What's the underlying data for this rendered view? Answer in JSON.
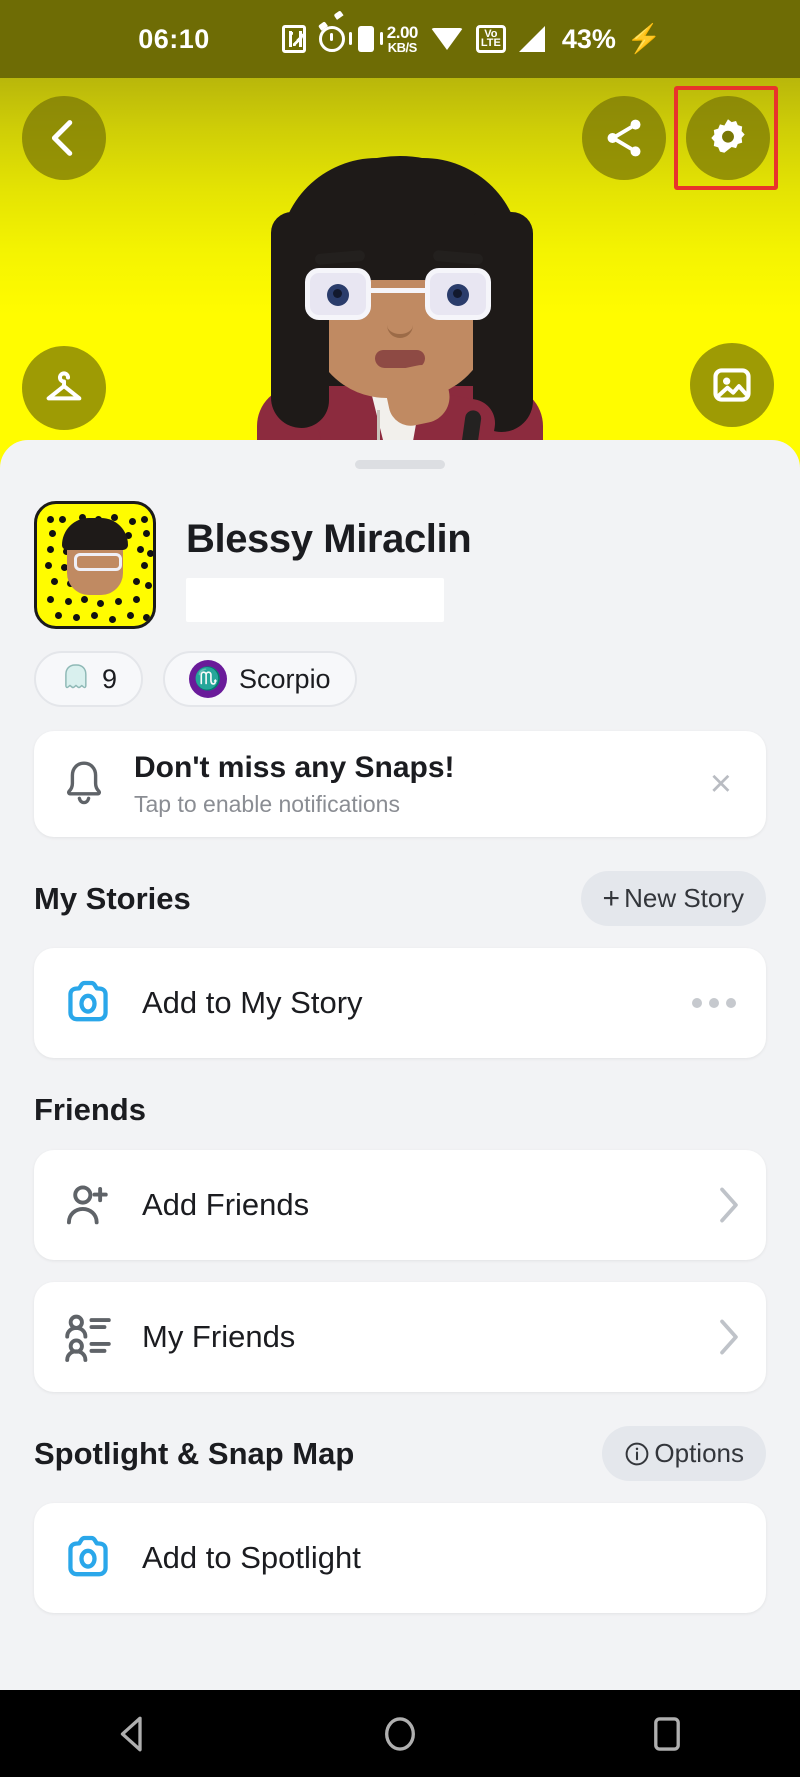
{
  "status_bar": {
    "time": "06:10",
    "network_speed_value": "2.00",
    "network_speed_unit": "KB/S",
    "volte_top": "Vo",
    "volte_bottom": "LTE",
    "battery": "43%",
    "icons": [
      "nfc-icon",
      "alarm-icon",
      "vibrate-icon",
      "network-speed-icon",
      "wifi-icon",
      "volte-icon",
      "signal-icon",
      "battery-icon",
      "charging-bolt-icon"
    ]
  },
  "header": {
    "back_label": "Back",
    "share_label": "Share",
    "settings_label": "Settings",
    "closet_label": "Bitmoji Fashion",
    "photo_label": "Change Background",
    "highlight_color": "#E8342B",
    "background_yellow": "#FFFC00"
  },
  "profile": {
    "display_name": "Blessy Miraclin",
    "username_redacted": "",
    "snapcode_label": "Snapcode",
    "badges": [
      {
        "icon": "ghost-icon",
        "label": "9",
        "type": "snap-score"
      },
      {
        "icon": "zodiac-icon",
        "glyph": "♏",
        "label": "Scorpio",
        "type": "astrology",
        "color": "#6A1B9A"
      }
    ]
  },
  "notification": {
    "title": "Don't miss any Snaps!",
    "subtitle": "Tap to enable notifications",
    "icon": "bell-icon",
    "close_label": "×"
  },
  "sections": [
    {
      "title": "My Stories",
      "action": {
        "label": "New Story",
        "icon": "plus-icon"
      },
      "rows": [
        {
          "icon": "camera-icon",
          "label": "Add to My Story",
          "trailing": "more-dots"
        }
      ]
    },
    {
      "title": "Friends",
      "action": null,
      "rows": [
        {
          "icon": "add-person-icon",
          "label": "Add Friends",
          "trailing": "chevron"
        },
        {
          "icon": "friends-list-icon",
          "label": "My Friends",
          "trailing": "chevron"
        }
      ]
    },
    {
      "title": "Spotlight & Snap Map",
      "action": {
        "label": "Options",
        "icon": "info-icon"
      },
      "rows": [
        {
          "icon": "camera-icon",
          "label": "Add to Spotlight",
          "trailing": "none"
        }
      ]
    }
  ],
  "navbar": {
    "items": [
      {
        "icon": "back-triangle-icon",
        "label": "Back"
      },
      {
        "icon": "home-circle-icon",
        "label": "Home"
      },
      {
        "icon": "recents-square-icon",
        "label": "Recents"
      }
    ]
  }
}
